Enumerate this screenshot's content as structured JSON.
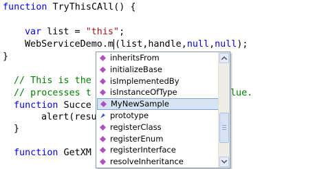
{
  "code": {
    "line1_kw": "function",
    "line1_rest": " TryThisCAll() {",
    "line2_kw": "var",
    "line2_mid": " list = ",
    "line2_str": "\"this\"",
    "line2_end": ";",
    "line3_a": "WebServiceDemo.m",
    "line3_b": "(list,handle,",
    "line3_null1": "null",
    "line3_comma": ",",
    "line3_null2": "null",
    "line3_end": ");",
    "line4": "}",
    "line5_cmt": "// This is the",
    "line6_cmt_a": "// processes t",
    "line6_cmt_b": "lue.",
    "line7_kw": "function",
    "line7_rest": " Succe",
    "line8": "alert(resu",
    "line9": "}",
    "line10_kw": "function",
    "line10_rest": " GetXM"
  },
  "intellisense": {
    "items": [
      {
        "label": "inheritsFrom",
        "icon": "method-icon"
      },
      {
        "label": "initializeBase",
        "icon": "method-icon"
      },
      {
        "label": "isImplementedBy",
        "icon": "method-icon"
      },
      {
        "label": "isInstanceOfType",
        "icon": "method-icon"
      },
      {
        "label": "MyNewSample",
        "icon": "method-icon",
        "selected": true
      },
      {
        "label": "prototype",
        "icon": "property-icon"
      },
      {
        "label": "registerClass",
        "icon": "method-icon"
      },
      {
        "label": "registerEnum",
        "icon": "method-icon"
      },
      {
        "label": "registerInterface",
        "icon": "method-icon"
      },
      {
        "label": "resolveInheritance",
        "icon": "method-icon"
      }
    ]
  },
  "colors": {
    "keyword": "#0000ff",
    "string": "#a31515",
    "comment": "#008000",
    "method_icon": "#b04ec4",
    "property_icon": "#3c5fc0",
    "selection": "#d6e3f3"
  }
}
